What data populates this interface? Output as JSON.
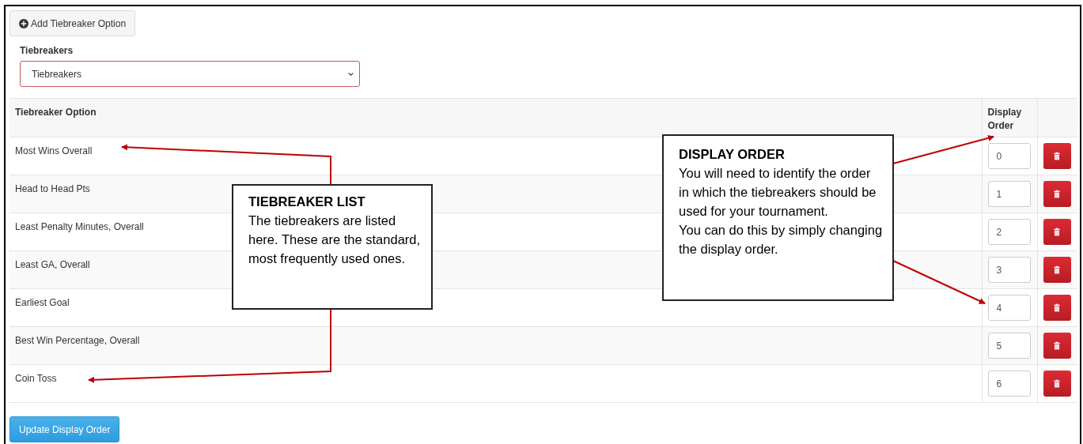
{
  "add_button": {
    "label": "Add Tiebreaker Option"
  },
  "tiebreakers_select": {
    "label": "Tiebreakers",
    "value": "Tiebreakers",
    "invalid": true
  },
  "table": {
    "columns": [
      "Tiebreaker Option",
      "Display Order"
    ],
    "rows": [
      {
        "option": "Most Wins Overall",
        "display_order": "0"
      },
      {
        "option": "Head to Head Pts",
        "display_order": "1"
      },
      {
        "option": "Least Penalty Minutes, Overall",
        "display_order": "2"
      },
      {
        "option": "Least GA, Overall",
        "display_order": "3"
      },
      {
        "option": "Earliest Goal",
        "display_order": "4"
      },
      {
        "option": "Best Win Percentage, Overall",
        "display_order": "5"
      },
      {
        "option": "Coin Toss",
        "display_order": "6"
      }
    ]
  },
  "update_button": {
    "label": "Update Display Order"
  },
  "callouts": [
    {
      "title": "TIEBREAKER LIST",
      "paragraphs": [
        "The tiebreakers are listed here. These are the standard, most frequently used ones."
      ]
    },
    {
      "title": "DISPLAY ORDER",
      "paragraphs": [
        "You will need to identify the order in which the tiebreakers should be used for your tournament.",
        "You can do this by simply changing the display order."
      ]
    }
  ]
}
